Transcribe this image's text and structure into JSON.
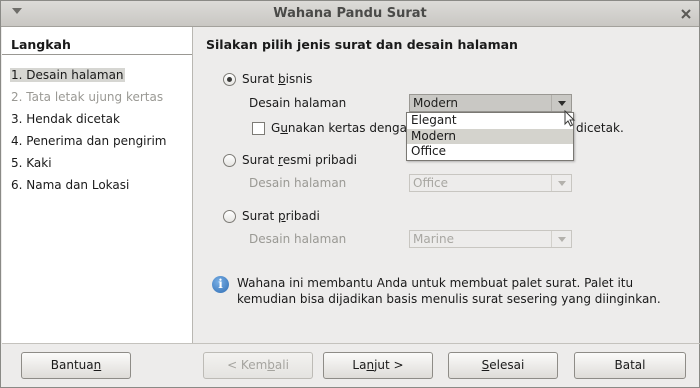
{
  "window": {
    "title": "Wahana Pandu Surat"
  },
  "steps": {
    "heading": "Langkah",
    "items": [
      {
        "label": "1. Desain halaman",
        "state": "active"
      },
      {
        "label": "2. Tata letak ujung kertas",
        "state": "disabled"
      },
      {
        "label": "3. Hendak dicetak",
        "state": "normal"
      },
      {
        "label": "4. Penerima dan pengirim",
        "state": "normal"
      },
      {
        "label": "5. Kaki",
        "state": "normal"
      },
      {
        "label": "6. Nama dan Lokasi",
        "state": "normal"
      }
    ]
  },
  "main": {
    "heading": "Silakan pilih jenis surat dan desain halaman",
    "options": [
      {
        "label_pre": "Surat ",
        "label_ul": "b",
        "label_post": "isnis",
        "checked": true,
        "design_label": "Desain halaman",
        "design_value": "Modern"
      },
      {
        "label_pre": "Surat ",
        "label_ul": "r",
        "label_post": "esmi pribadi",
        "checked": false,
        "design_label": "Desain halaman",
        "design_value": "Office"
      },
      {
        "label_pre": "Surat ",
        "label_ul": "p",
        "label_post": "ribadi",
        "checked": false,
        "design_label": "Desain halaman",
        "design_value": "Marine"
      }
    ],
    "checkbox": {
      "label_pre": "G",
      "label_ul": "u",
      "label_post": "nakan kertas dengan",
      "label_tail": "dicetak.",
      "checked": false
    },
    "dropdown_options": [
      "Elegant",
      "Modern",
      "Office"
    ],
    "dropdown_highlighted": "Modern",
    "info": "Wahana ini membantu Anda untuk membuat palet surat. Palet itu kemudian bisa dijadikan basis menulis surat sesering yang diinginkan."
  },
  "buttons": {
    "help": {
      "pre": "Bantua",
      "ul": "n",
      "post": ""
    },
    "back": {
      "pre": "< Kem",
      "ul": "b",
      "post": "ali"
    },
    "next": {
      "pre": "La",
      "ul": "n",
      "post": "jut >"
    },
    "finish": {
      "pre": "",
      "ul": "S",
      "post": "elesai"
    },
    "cancel": {
      "pre": "Batal",
      "ul": "",
      "post": ""
    }
  },
  "colors": {
    "window_bg": "#edeceb",
    "panel_bg": "#ffffff",
    "info_blue": "#2f6db3"
  }
}
